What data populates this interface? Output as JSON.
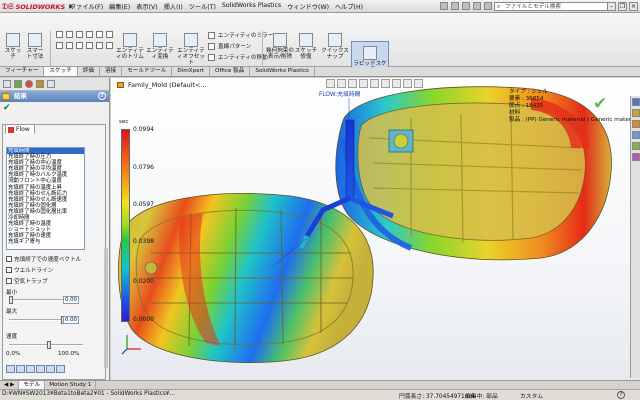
{
  "menubar": {
    "brand": "SOLIDWORKS",
    "items": [
      "ファイル(F)",
      "編集(E)",
      "表示(V)",
      "挿入(I)",
      "ツール(T)",
      "SolidWorks Plastics",
      "ウィンドウ(W)",
      "ヘルプ(H)"
    ],
    "search_placeholder": "ファイルとモデル検索"
  },
  "commands": {
    "sketch": "スケッチ",
    "smart_dim": "スマート寸法",
    "trim_entities": "エンティティのトリム",
    "convert_entities": "エンティティ変換",
    "offset_entities": "エンティティオフセット",
    "mirror_entities": "エンティティのミラー",
    "linear_pattern": "直線パターン",
    "move_entities": "エンティティの移動",
    "display_relations": "幾何拘束の表示/削除",
    "repair_sketch": "スケッチ修復",
    "quick_snaps": "クイックスナップ",
    "rapid_sketch": "ラピッドスケッチ"
  },
  "tabs": [
    "フィーチャー",
    "スケッチ",
    "評価",
    "溶接",
    "モールドツール",
    "DimXpert",
    "Office 製品",
    "SolidWorks Plastics"
  ],
  "active_tab": "スケッチ",
  "panel": {
    "header": "結果",
    "flow_tab": "Flow",
    "result_items": [
      "充填時間",
      "充填終了時の圧力",
      "充填終了時の中心温度",
      "充填終了時の平均温度",
      "充填終了時のバルク温度",
      "流動フロント中心温度",
      "充填終了時の温度上昇",
      "充填終了時のせん断応力",
      "充填終了時のせん断速度",
      "充填終了時の固化層",
      "充填終了時の固化層比率",
      "冷却時間",
      "充填終了時の温度",
      "ショートショット",
      "充填終了時の速度",
      "充填ギア寄与"
    ],
    "selected_index": 0,
    "checkboxes": [
      "充填終了での速度ベクトル",
      "ウエルドライン",
      "空気トラップ"
    ],
    "min_label": "最小",
    "max_label": "最大",
    "speed_label": "速度",
    "min_value": "0.00",
    "max_value": "0.00",
    "speed_min": "0.0%",
    "speed_max": "100.0%"
  },
  "viewport": {
    "doc_title": "Family_Mold  (Default<...",
    "flow_annotation": "FLOW:充填時間",
    "info": {
      "type": "タイプ : シェル",
      "elements": "要素 : 36854",
      "nodes": "節点 : 18435",
      "label4": "材料",
      "material": "製品 : (PP) Generic material / Generic material"
    },
    "legend_unit": "sec",
    "legend_values": [
      "0.0994",
      "0.0796",
      "0.0597",
      "0.0398",
      "0.0200",
      "0.0000"
    ]
  },
  "bottom_tabs": [
    "モデル",
    "Motion Study 1"
  ],
  "status": {
    "path": "D:¥WN¥SW2013¥Beta1toBeta2¥01 - SolidWorks Plastics¥...",
    "length": "円弧長さ: 37.70454971mm",
    "edit": "編集中: 部品",
    "units": "カスタム",
    "help": "?"
  },
  "colors": {
    "brand_red": "#c8102e",
    "selection_blue": "#3169c6",
    "panel_header": "#5d82bd"
  }
}
